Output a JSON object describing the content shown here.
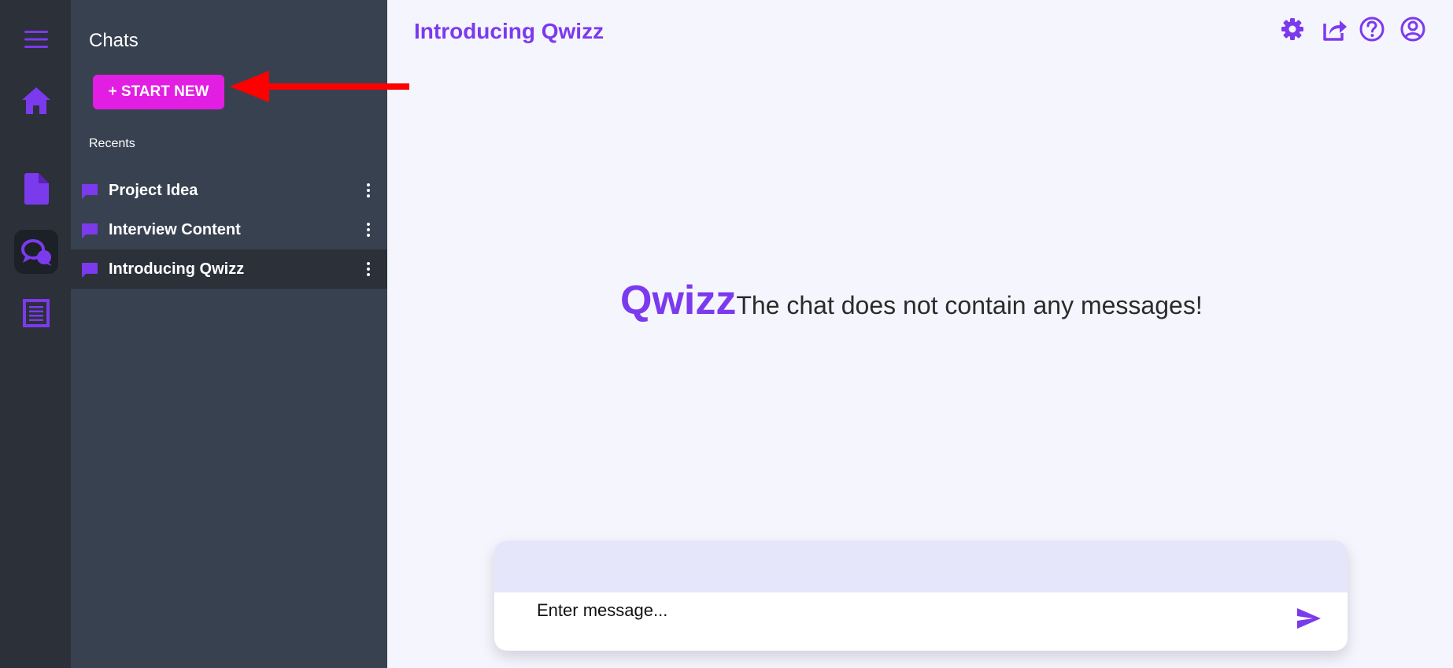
{
  "chats_panel": {
    "title": "Chats",
    "start_new_label": "+ START NEW",
    "recents_label": "Recents",
    "items": [
      {
        "label": "Project Idea",
        "active": false
      },
      {
        "label": "Interview Content",
        "active": false
      },
      {
        "label": "Introducing Qwizz",
        "active": true
      }
    ]
  },
  "header": {
    "title": "Introducing Qwizz",
    "icons": [
      "gear-icon",
      "share-icon",
      "help-icon",
      "account-icon"
    ]
  },
  "empty_state": {
    "brand": "Qwizz",
    "message": "The chat does not contain any messages!"
  },
  "composer": {
    "placeholder": "Enter message..."
  },
  "rail": {
    "icons": [
      "menu-icon",
      "home-icon",
      "document-icon",
      "chat-icon",
      "notes-icon"
    ],
    "active": "chat-icon"
  },
  "colors": {
    "accent": "#7c3aed",
    "start_button": "#e21ee2",
    "panel_bg": "#384150",
    "rail_bg": "#2b3039",
    "main_bg": "#f5f5fe",
    "annotation_arrow": "#ff0000"
  }
}
